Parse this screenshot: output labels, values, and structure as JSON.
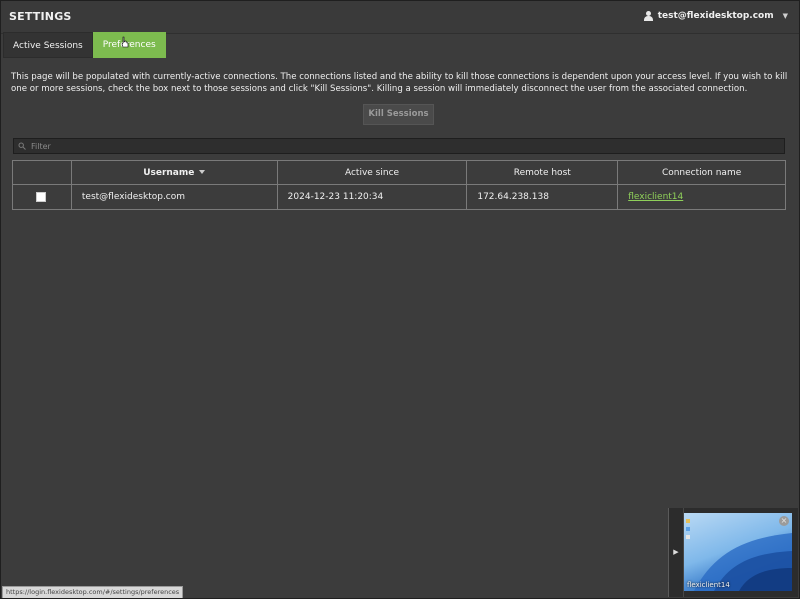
{
  "header": {
    "title": "SETTINGS",
    "user": "test@flexidesktop.com"
  },
  "tabs": [
    {
      "label": "Active Sessions",
      "active": true
    },
    {
      "label": "Preferences",
      "active": false
    }
  ],
  "description": "This page will be populated with currently-active connections. The connections listed and the ability to kill those connections is dependent upon your access level. If you wish to kill one or more sessions, check the box next to those sessions and click \"Kill Sessions\". Killing a session will immediately disconnect the user from the associated connection.",
  "kill_button": "Kill Sessions",
  "filter": {
    "placeholder": "Filter",
    "value": ""
  },
  "table": {
    "columns": [
      "",
      "Username",
      "Active since",
      "Remote host",
      "Connection name"
    ],
    "rows": [
      {
        "checked": false,
        "username": "test@flexidesktop.com",
        "active_since": "2024-12-23 11:20:34",
        "remote_host": "172.64.238.138",
        "connection_name": "flexiclient14"
      }
    ]
  },
  "status_bar": "https://login.flexidesktop.com/#/settings/preferences",
  "thumbnail": {
    "label": "flexiclient14"
  },
  "colors": {
    "background": "#3c3c3c",
    "accent_tab": "#7dbb4f",
    "link": "#8fd05a"
  }
}
